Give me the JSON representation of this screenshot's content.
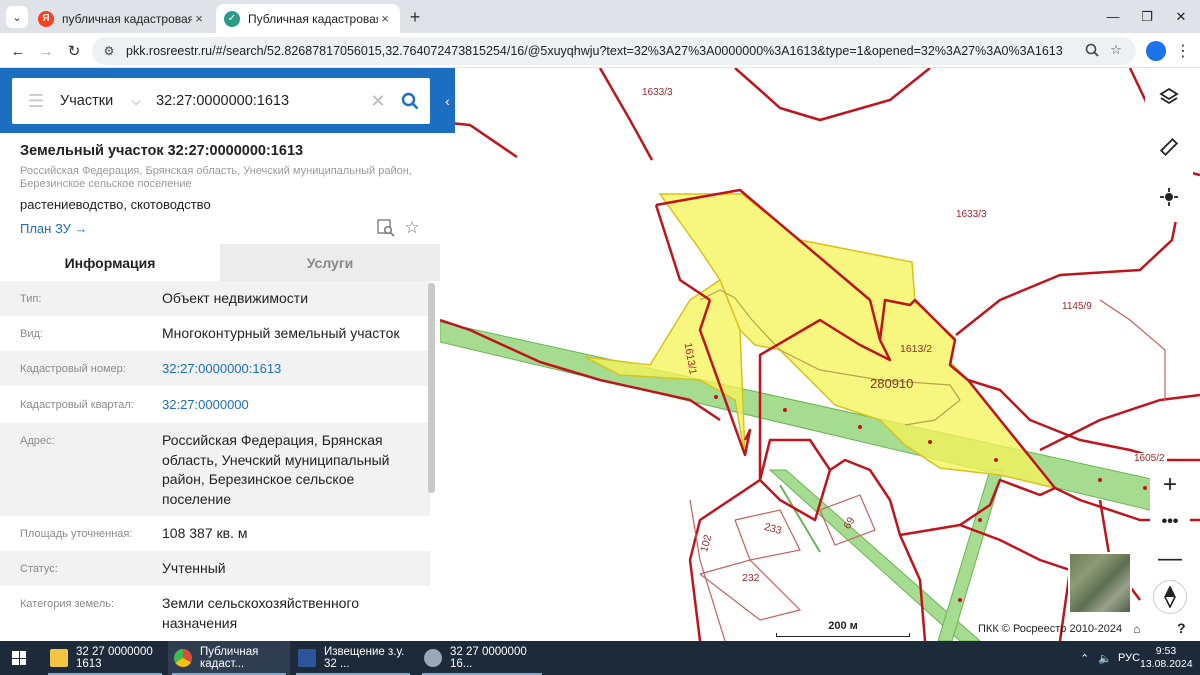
{
  "browser": {
    "tabs": [
      {
        "label": "публичная кадастровая карта",
        "favicon": "yandex-icon",
        "color": "#fc3f1d"
      },
      {
        "label": "Публичная кадастровая карта",
        "favicon": "rosreestr-icon",
        "color": "#1c6ec1"
      }
    ],
    "url": "pkk.rosreestr.ru/#/search/52.82687817056015,32.764072473815254/16/@5xuyqhwju?text=32%3A27%3A0000000%3A1613&type=1&opened=32%3A27%3A0%3A1613"
  },
  "search": {
    "type": "Участки",
    "query": "32:27:0000000:1613"
  },
  "object": {
    "title": "Земельный участок 32:27:0000000:1613",
    "address_short": "Российская Федерация, Брянская область, Унечский муниципальный район, Березинское сельское поселение",
    "use": "растениеводство, скотоводство",
    "plan_link": "План ЗУ →"
  },
  "panel_tabs": [
    "Информация",
    "Услуги"
  ],
  "info_rows": [
    {
      "key": "Тип:",
      "value": "Объект недвижимости",
      "link": false
    },
    {
      "key": "Вид:",
      "value": "Многоконтурный земельный участок",
      "link": false
    },
    {
      "key": "Кадастровый номер:",
      "value": "32:27:0000000:1613",
      "link": true
    },
    {
      "key": "Кадастровый квартал:",
      "value": "32:27:0000000",
      "link": true
    },
    {
      "key": "Адрес:",
      "value": "Российская Федерация, Брянская область, Унечский муниципальный район, Березинское сельское поселение",
      "link": false
    },
    {
      "key": "Площадь уточненная:",
      "value": "108 387 кв. м",
      "link": false
    },
    {
      "key": "Статус:",
      "value": "Учтенный",
      "link": false
    },
    {
      "key": "Категория земель:",
      "value": "Земли сельскохозяйственного назначения",
      "link": false
    }
  ],
  "map": {
    "labels": [
      "1633/3",
      "1633/3",
      "1145/9",
      "1613/2",
      "1613/1",
      "280910",
      "1605/2",
      "233",
      "69",
      "102",
      "232"
    ],
    "scale": "200 м",
    "copyright": "ПКК © Росреестр 2010-2024",
    "colors": {
      "parcel_border": "#c0141c",
      "selected_fill": "#f5f35a",
      "road": "#8fd07a"
    }
  },
  "taskbar": {
    "items": [
      {
        "label": "32 27 0000000 1613",
        "icon": "folder-icon",
        "color": "#f4c542"
      },
      {
        "label": "Публичная кадаст...",
        "icon": "chrome-icon",
        "color": "#dd4b39"
      },
      {
        "label": "Извещение з.у. 32 ...",
        "icon": "word-icon",
        "color": "#2b579a"
      },
      {
        "label": "32  27  0000000  16...",
        "icon": "paint-icon",
        "color": "#9aa7b8"
      }
    ],
    "lang": "РУС",
    "time": "9:53",
    "date": "13.08.2024"
  }
}
